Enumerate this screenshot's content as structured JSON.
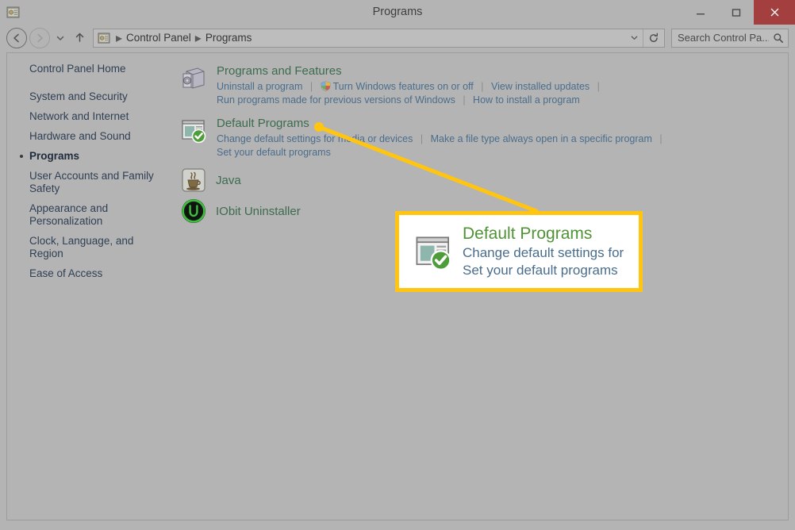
{
  "window": {
    "title": "Programs",
    "icon": "control-panel-icon",
    "controls": {
      "minimize": "minimize-icon",
      "maximize": "maximize-icon",
      "close": "close-icon"
    }
  },
  "nav": {
    "back": "back-arrow-icon",
    "forward": "forward-arrow-icon",
    "recent": "chevron-down-icon",
    "up": "up-arrow-icon",
    "address_icon": "control-panel-icon",
    "breadcrumbs": [
      "Control Panel",
      "Programs"
    ],
    "breadcrumb_separator": "▸",
    "dropdown": "chevron-down-icon",
    "refresh": "refresh-icon"
  },
  "search": {
    "value": "Search Control Pa...",
    "placeholder": "Search Control Panel",
    "icon": "search-icon"
  },
  "sidebar": {
    "home": "Control Panel Home",
    "items": [
      {
        "label": "System and Security",
        "current": false
      },
      {
        "label": "Network and Internet",
        "current": false
      },
      {
        "label": "Hardware and Sound",
        "current": false
      },
      {
        "label": "Programs",
        "current": true
      },
      {
        "label": "User Accounts and Family Safety",
        "current": false
      },
      {
        "label": "Appearance and Personalization",
        "current": false
      },
      {
        "label": "Clock, Language, and Region",
        "current": false
      },
      {
        "label": "Ease of Access",
        "current": false
      }
    ]
  },
  "main": {
    "categories": [
      {
        "title": "Programs and Features",
        "icon": "programs-and-features-icon",
        "line1": [
          {
            "text": "Uninstall a program",
            "shield": false
          },
          {
            "text": "Turn Windows features on or off",
            "shield": true
          },
          {
            "text": "View installed updates",
            "shield": false
          }
        ],
        "line1_trailing_separator": true,
        "line2": [
          {
            "text": "Run programs made for previous versions of Windows",
            "shield": false
          },
          {
            "text": "How to install a program",
            "shield": false
          }
        ],
        "line2_trailing_separator": false
      },
      {
        "title": "Default Programs",
        "icon": "default-programs-icon",
        "line1": [
          {
            "text": "Change default settings for media or devices",
            "shield": false
          },
          {
            "text": "Make a file type always open in a specific program",
            "shield": false
          }
        ],
        "line1_trailing_separator": true,
        "line2": [
          {
            "text": "Set your default programs",
            "shield": false
          }
        ],
        "line2_trailing_separator": false
      }
    ],
    "apps": [
      {
        "name": "Java",
        "icon": "java-icon"
      },
      {
        "name": "IObit Uninstaller",
        "icon": "iobit-uninstaller-icon"
      }
    ]
  },
  "callout": {
    "title": "Default Programs",
    "line1": "Change default settings for",
    "line2": "Set your default programs",
    "icon": "default-programs-icon",
    "border_color": "#ffc511",
    "line_color": "#ffc511"
  },
  "colors": {
    "window_bg": "#b4b4b4",
    "heading_green": "#3d6b4f",
    "link_blue": "#4a6d8c",
    "close_red": "#a33f3f",
    "callout_yellow": "#ffc511",
    "callout_title_green": "#4f9336"
  }
}
